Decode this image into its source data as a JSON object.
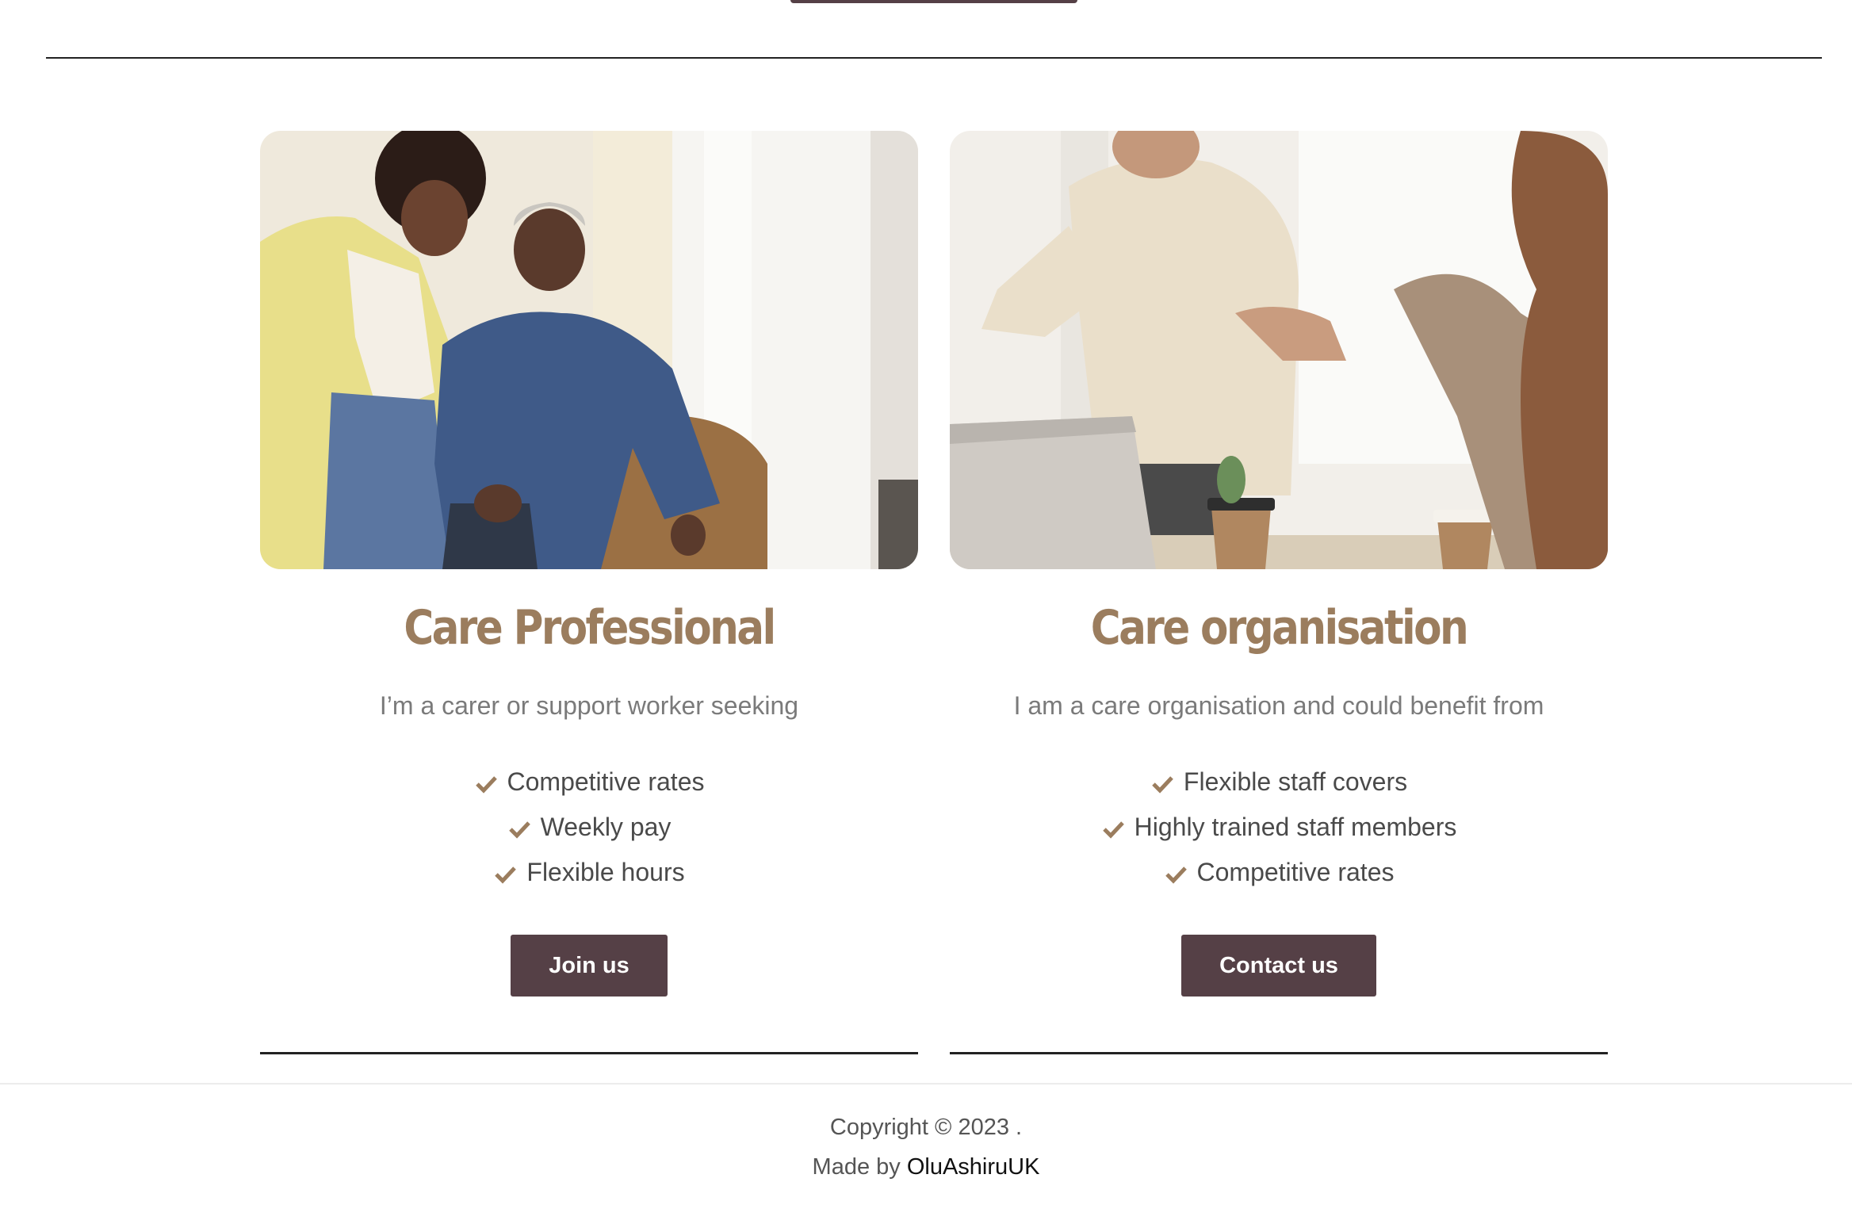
{
  "cards": [
    {
      "image_alt": "carer-assisting-elderly-man",
      "title": "Care Professional",
      "subtitle": "I’m a carer or support worker seeking",
      "features": [
        "Competitive rates",
        "Weekly pay",
        "Flexible hours"
      ],
      "button_label": "Join us"
    },
    {
      "image_alt": "business-handshake",
      "title": "Care organisation",
      "subtitle": "I am a care organisation and could benefit from",
      "features": [
        "Flexible staff covers",
        "Highly trained staff members",
        "Competitive rates"
      ],
      "button_label": "Contact us"
    }
  ],
  "footer": {
    "copyright": "Copyright © 2023 .",
    "made_by_prefix": "Made by ",
    "made_by_link": "OluAshiruUK"
  },
  "colors": {
    "accent": "#9b7d5e",
    "button": "#554046",
    "text": "#4a4a4a"
  },
  "icons": {
    "feature_bullet": "check-icon"
  }
}
